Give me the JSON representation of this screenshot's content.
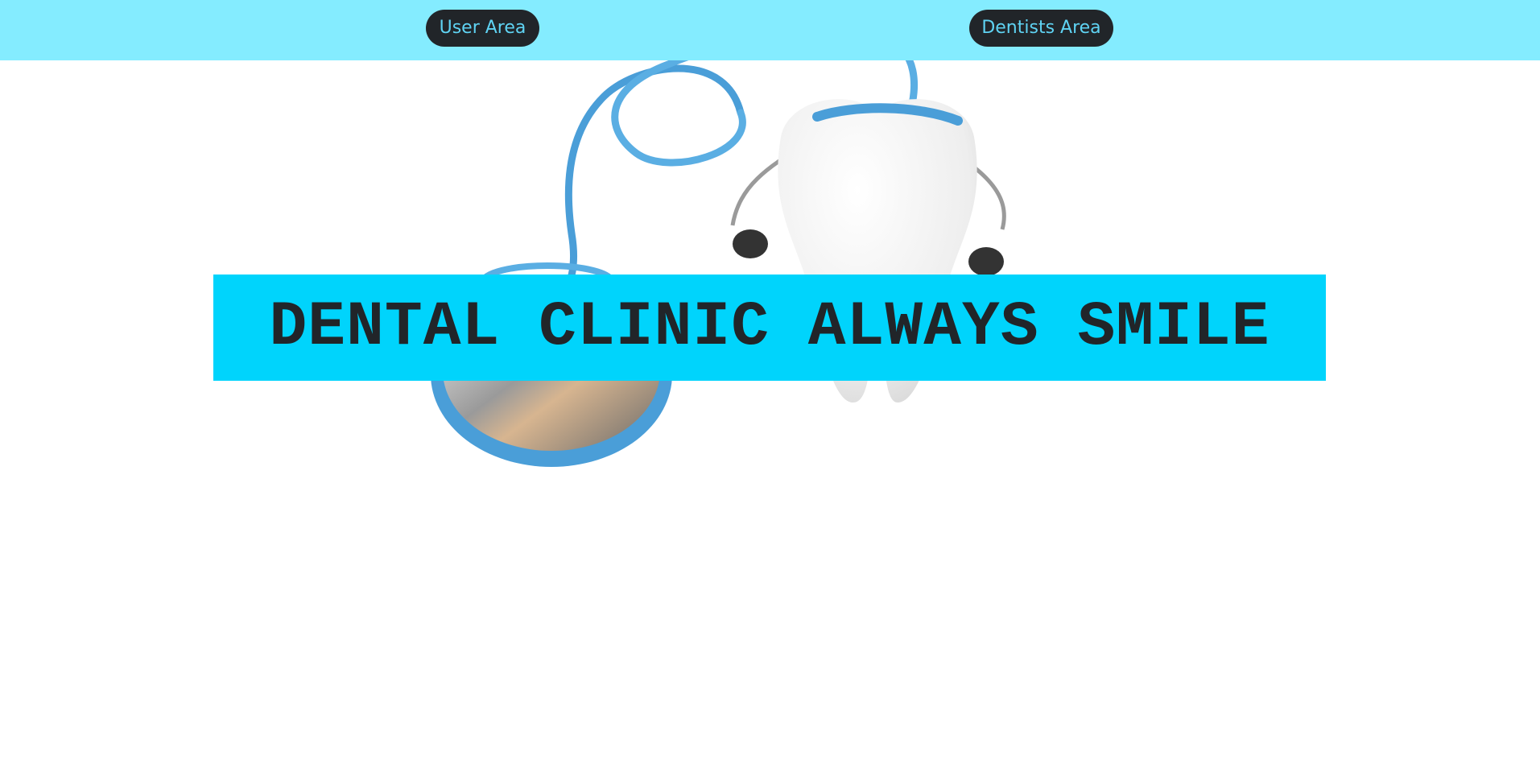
{
  "header": {
    "user_area_label": "User Area",
    "dentists_area_label": "Dentists Area"
  },
  "hero": {
    "title": "DENTAL CLINIC ALWAYS SMILE",
    "image_icon": "tooth-stethoscope-illustration"
  },
  "colors": {
    "header_bg": "#84ecff",
    "button_bg": "#212529",
    "button_text": "#5fd3f3",
    "banner_bg": "#00d4fc",
    "banner_text": "#212529"
  }
}
